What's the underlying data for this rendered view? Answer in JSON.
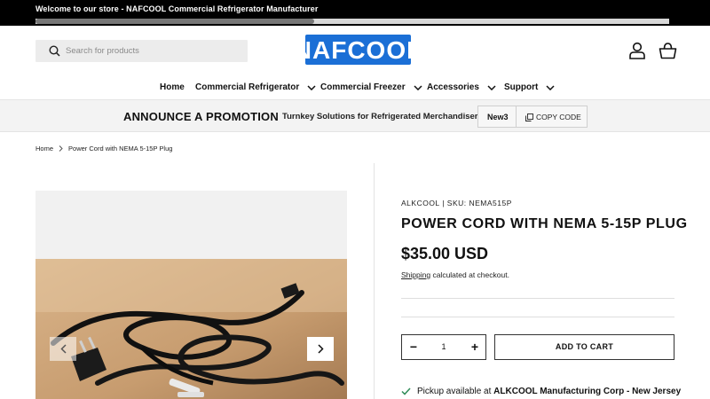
{
  "announcement": {
    "text": "Welcome to our store - NAFCOOL Commercial Refrigerator Manufacturer",
    "scroll_position": 0.44
  },
  "header": {
    "search_placeholder": "Search for products",
    "logo_text": "NAFCOOL",
    "brand_color": "#1b6fd6",
    "icons": [
      "search-icon",
      "account-icon",
      "basket-icon"
    ]
  },
  "nav": {
    "items": [
      {
        "label": "Home",
        "dropdown": false
      },
      {
        "label": "Commercial Refrigerator",
        "dropdown": true
      },
      {
        "label": "Commercial Freezer",
        "dropdown": true
      },
      {
        "label": "Accessories",
        "dropdown": true
      },
      {
        "label": "Support",
        "dropdown": true
      }
    ]
  },
  "promo": {
    "title": "ANNOUNCE A PROMOTION",
    "subtitle": "Turnkey Solutions for Refrigerated Merchandisers",
    "code": "New3",
    "copy_label": "COPY CODE"
  },
  "breadcrumb": {
    "home": "Home",
    "current": "Power Cord with NEMA 5-15P Plug"
  },
  "product": {
    "vendor_line": "ALKCOOL  |  SKU: NEMA515P",
    "title": "POWER CORD WITH NEMA 5-15P PLUG",
    "price": "$35.00 USD",
    "shipping_link": "Shipping",
    "shipping_rest": " calculated at checkout.",
    "quantity": "1",
    "minus": "−",
    "plus": "+",
    "add_to_cart": "ADD TO CART",
    "pickup_prefix": "Pickup available at ",
    "pickup_location": "ALKCOOL Manufacturing Corp - New Jersey"
  }
}
